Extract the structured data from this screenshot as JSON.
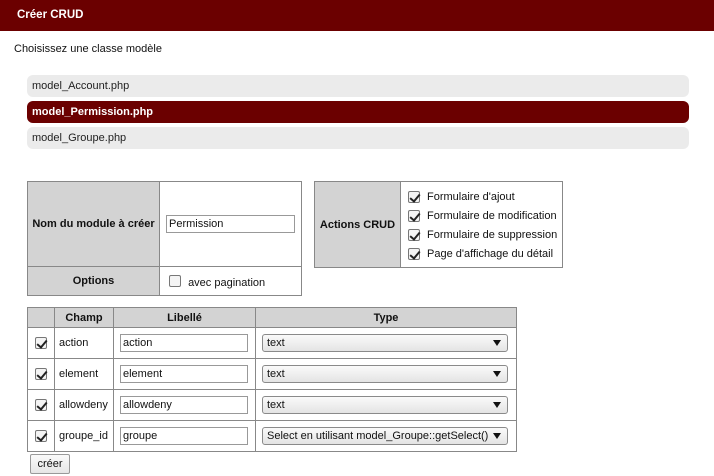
{
  "window": {
    "title": "Créer CRUD"
  },
  "intro": "Choisissez une classe modèle",
  "models": [
    {
      "label": "model_Account.php",
      "selected": false
    },
    {
      "label": "model_Permission.php",
      "selected": true
    },
    {
      "label": "model_Groupe.php",
      "selected": false
    }
  ],
  "module": {
    "name_label": "Nom du module à créer",
    "name_value": "Permission",
    "options_label": "Options",
    "pagination_label": "avec pagination",
    "pagination_checked": false
  },
  "crud": {
    "label": "Actions CRUD",
    "actions": [
      {
        "label": "Formulaire d'ajout",
        "checked": true
      },
      {
        "label": "Formulaire de modification",
        "checked": true
      },
      {
        "label": "Formulaire de suppression",
        "checked": true
      },
      {
        "label": "Page d'affichage du détail",
        "checked": true
      }
    ]
  },
  "fields_table": {
    "headers": {
      "champ": "Champ",
      "libelle": "Libellé",
      "type": "Type"
    },
    "rows": [
      {
        "checked": true,
        "champ": "action",
        "libelle": "action",
        "type": "text"
      },
      {
        "checked": true,
        "champ": "element",
        "libelle": "element",
        "type": "text"
      },
      {
        "checked": true,
        "champ": "allowdeny",
        "libelle": "allowdeny",
        "type": "text"
      },
      {
        "checked": true,
        "champ": "groupe_id",
        "libelle": "groupe",
        "type": "Select en utilisant model_Groupe::getSelect()"
      }
    ]
  },
  "submit_label": "créer"
}
